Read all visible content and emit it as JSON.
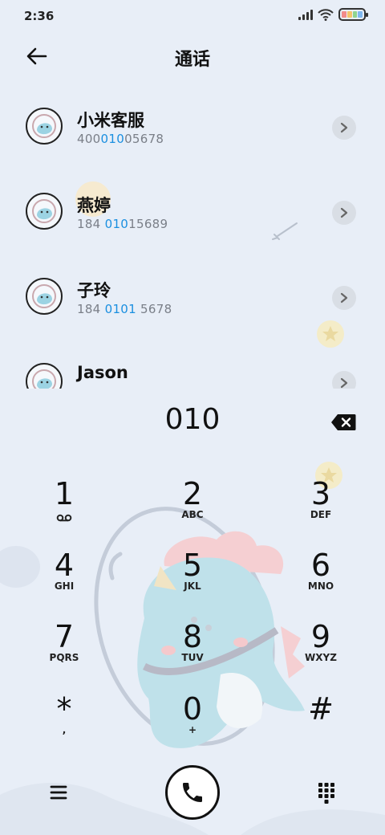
{
  "status": {
    "time": "2:36",
    "icons": [
      "signal-icon",
      "wifi-icon",
      "battery-icon"
    ]
  },
  "header": {
    "title": "通话",
    "back_icon": "back-arrow-icon"
  },
  "results": [
    {
      "name": "小米客服",
      "number_pre": "400",
      "number_match": "010",
      "number_post": "05678"
    },
    {
      "name": "燕婷",
      "number_pre": "184 ",
      "number_match": "010",
      "number_post": "15689"
    },
    {
      "name": "子玲",
      "number_pre": "184 ",
      "number_match": "0101",
      "number_post": " 5678"
    },
    {
      "name": "Jason",
      "number_pre": "",
      "number_match": "",
      "number_post": ""
    }
  ],
  "dialer": {
    "input": "010",
    "keys": [
      {
        "digit": "1",
        "letters": ""
      },
      {
        "digit": "2",
        "letters": "ABC"
      },
      {
        "digit": "3",
        "letters": "DEF"
      },
      {
        "digit": "4",
        "letters": "GHI"
      },
      {
        "digit": "5",
        "letters": "JKL"
      },
      {
        "digit": "6",
        "letters": "MNO"
      },
      {
        "digit": "7",
        "letters": "PQRS"
      },
      {
        "digit": "8",
        "letters": "TUV"
      },
      {
        "digit": "9",
        "letters": "WXYZ"
      },
      {
        "digit": "*",
        "letters": ","
      },
      {
        "digit": "0",
        "letters": "+"
      },
      {
        "digit": "#",
        "letters": ""
      }
    ]
  },
  "bottom": {
    "menu_icon": "menu-icon",
    "call_icon": "phone-icon",
    "keypad_icon": "keypad-icon"
  },
  "colors": {
    "background": "#e8eef7",
    "match_highlight": "#1a8fe0",
    "chevron_bg": "#d9dee5"
  }
}
